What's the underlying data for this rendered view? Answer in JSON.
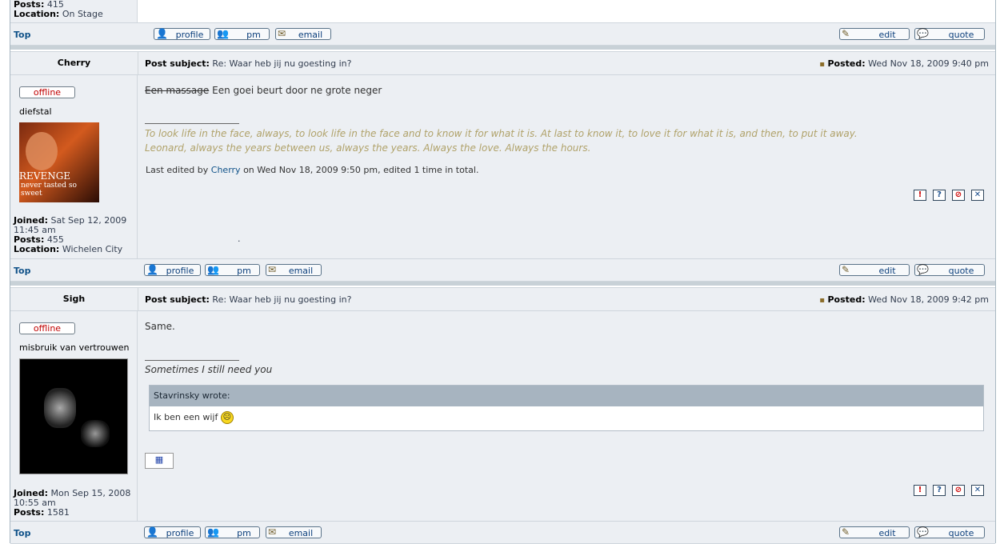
{
  "prev_post": {
    "posts_label": "Posts:",
    "posts_value": "415",
    "location_label": "Location:",
    "location_value": "On Stage",
    "top_link": "Top",
    "buttons": {
      "profile": "profile",
      "pm": "pm",
      "email": "email",
      "edit": "edit",
      "quote": "quote"
    }
  },
  "post1": {
    "author": "Cherry",
    "subject_label": "Post subject:",
    "subject": "Re: Waar heb jij nu goesting in?",
    "posted_label": "Posted:",
    "posted": "Wed Nov 18, 2009 9:40 pm",
    "status": "offline",
    "rank": "diefstal",
    "avatar_text_line1": "REVENGE",
    "avatar_text_line2": "never tasted so sweet",
    "joined_label": "Joined:",
    "joined": "Sat Sep 12, 2009 11:45 am",
    "posts_label": "Posts:",
    "posts": "455",
    "location_label": "Location:",
    "location": "Wichelen City",
    "struck_text": "Een massage",
    "body_text": "Een goei beurt door ne grote neger",
    "signature_line1": "To look life in the face, always, to look life in the face and to know it for what it is. At last to know it, to love it for what it is, and then, to put it away.",
    "signature_line2": "Leonard, always the years between us, always the years. Always the love. Always the hours.",
    "edited_prefix": "Last edited by",
    "edited_user": "Cherry",
    "edited_suffix": "on Wed Nov 18, 2009 9:50 pm, edited 1 time in total.",
    "dot": ".",
    "top_link": "Top",
    "buttons": {
      "profile": "profile",
      "pm": "pm",
      "email": "email",
      "edit": "edit",
      "quote": "quote"
    }
  },
  "post2": {
    "author": "Sigh",
    "subject_label": "Post subject:",
    "subject": "Re: Waar heb jij nu goesting in?",
    "posted_label": "Posted:",
    "posted": "Wed Nov 18, 2009 9:42 pm",
    "status": "offline",
    "rank": "misbruik van vertrouwen",
    "joined_label": "Joined:",
    "joined": "Mon Sep 15, 2008 10:55 am",
    "posts_label": "Posts:",
    "posts": "1581",
    "body_text": "Same.",
    "signature": "Sometimes I still need you",
    "quote_author": "Stavrinsky wrote:",
    "quote_text": "Ik ben een wijf",
    "top_link": "Top",
    "buttons": {
      "profile": "profile",
      "pm": "pm",
      "email": "email",
      "edit": "edit",
      "quote": "quote"
    }
  },
  "icons": {
    "report": "!",
    "info": "?",
    "warn": "⊘",
    "delete": "✕",
    "post_icon": "▪"
  },
  "colors": {
    "offline": "#c00000",
    "signature": "#b0a26a",
    "link": "#105289"
  }
}
